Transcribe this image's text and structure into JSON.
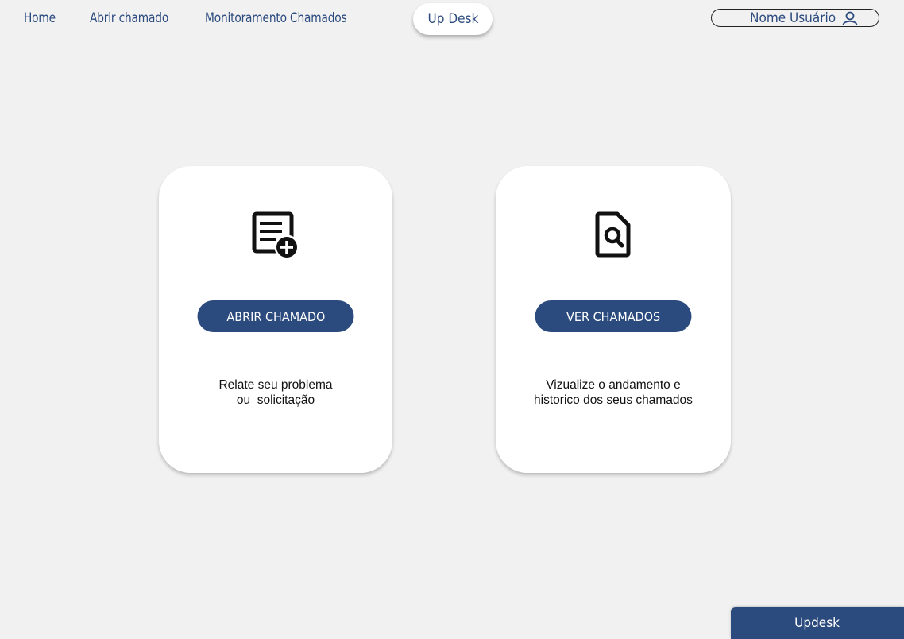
{
  "nav": {
    "home": "Home",
    "abrir_chamado": "Abrir chamado",
    "monitoramento": "Monitoramento Chamados",
    "brand": "Up Desk"
  },
  "user": {
    "name": "Nome Usuário",
    "icon": "user-icon"
  },
  "cards": [
    {
      "icon": "document-add-icon",
      "button_label": "ABRIR CHAMADO",
      "description_line1": "Relate seu problema",
      "description_line2": "ou  solicitação"
    },
    {
      "icon": "document-search-icon",
      "button_label": "VER CHAMADOS",
      "description_line1": "Vizualize o andamento e",
      "description_line2": "historico dos seus chamados"
    }
  ],
  "footer": {
    "label": "Updesk"
  },
  "colors": {
    "primary": "#2b4a7e",
    "background": "#f1f1f1",
    "card": "#ffffff"
  }
}
